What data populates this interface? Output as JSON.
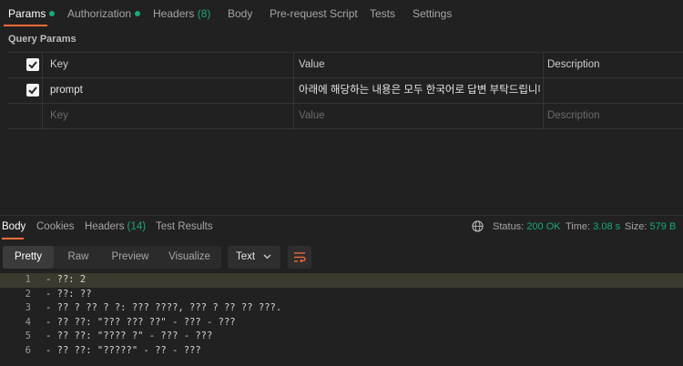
{
  "request_tabs": [
    {
      "label": "Params",
      "dot": true
    },
    {
      "label": "Authorization",
      "dot": true
    },
    {
      "label": "Headers",
      "count": "(8)"
    },
    {
      "label": "Body"
    },
    {
      "label": "Pre-request Script"
    },
    {
      "label": "Tests"
    },
    {
      "label": "Settings"
    }
  ],
  "query_params": {
    "title": "Query Params",
    "headers": {
      "key": "Key",
      "value": "Value",
      "description": "Description"
    },
    "rows": [
      {
        "key": "prompt",
        "value": "아래에 해당하는 내용은 모두 한국어로 답변 부탁드립니다 ↵ 오...",
        "description": ""
      }
    ],
    "placeholders": {
      "key": "Key",
      "value": "Value",
      "description": "Description"
    }
  },
  "response_tabs": [
    {
      "label": "Body"
    },
    {
      "label": "Cookies"
    },
    {
      "label": "Headers",
      "count": "(14)"
    },
    {
      "label": "Test Results"
    }
  ],
  "response_status": {
    "status_label": "Status:",
    "status_value": "200 OK",
    "time_label": "Time:",
    "time_value": "3.08 s",
    "size_label": "Size:",
    "size_value": "579 B"
  },
  "format_modes": [
    "Pretty",
    "Raw",
    "Preview",
    "Visualize"
  ],
  "format_type": "Text",
  "code_lines": [
    "- ??: 2",
    "- ??: ??",
    "- ?? ? ?? ? ?: ??? ????, ??? ? ?? ?? ???.",
    "- ?? ??: \"??? ??? ??\" - ??? - ???",
    "- ?? ??: \"???? ?\" - ??? - ???",
    "- ?? ??: \"?????\" - ?? - ???"
  ],
  "colors": {
    "accent": "#ff6c37",
    "success": "#19a974",
    "background": "#212121"
  }
}
